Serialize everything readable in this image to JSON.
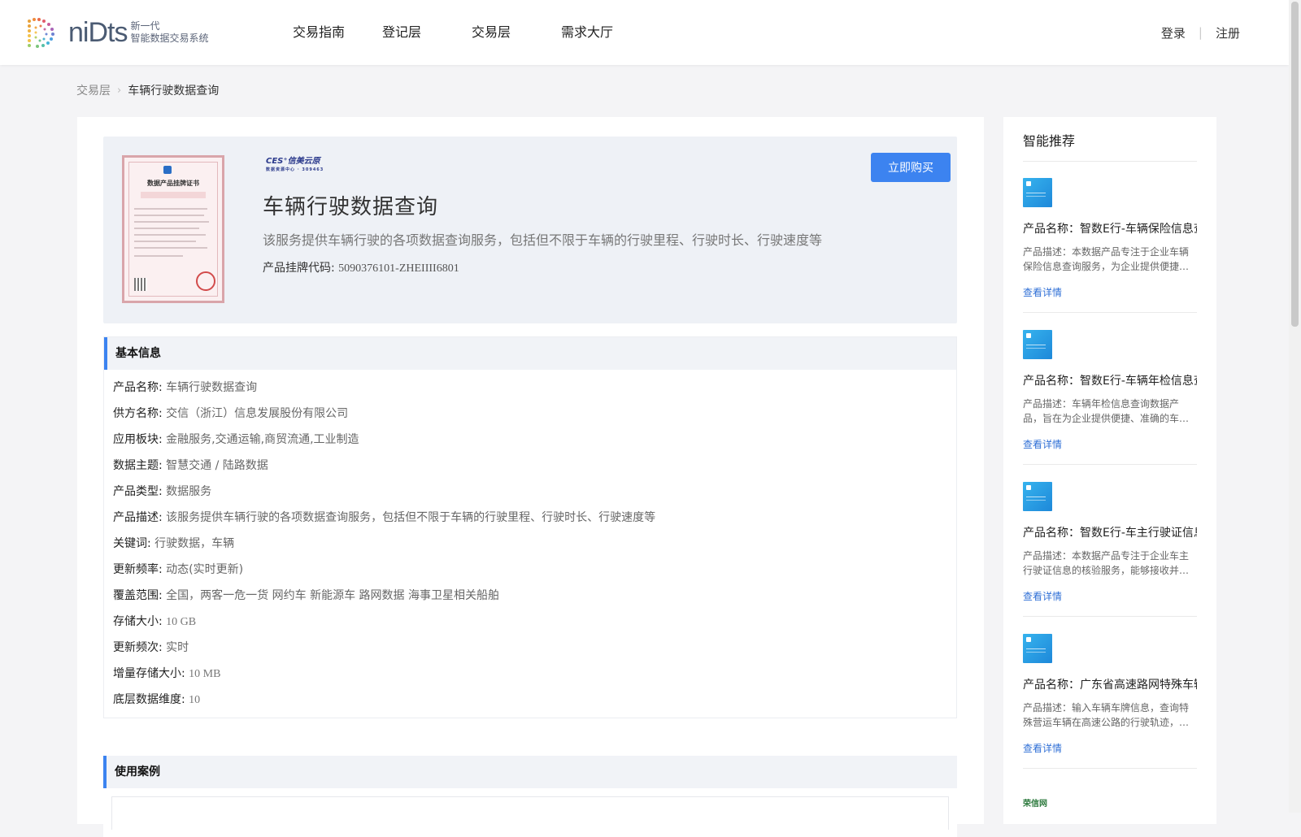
{
  "header": {
    "logo_word": "niDts",
    "logo_sub1": "新一代",
    "logo_sub2": "智能数据交易系统",
    "nav": [
      "交易指南",
      "登记层",
      "交易层",
      "需求大厅"
    ],
    "login": "登录",
    "register": "注册"
  },
  "breadcrumb": {
    "parent": "交易层",
    "current": "车辆行驶数据查询"
  },
  "product": {
    "ces_logo": "CES⁺信美云原",
    "ces_sub": "数据资源中心 · 309463",
    "cert_title": "数据产品挂牌证书",
    "title": "车辆行驶数据查询",
    "description": "该服务提供车辆行驶的各项数据查询服务，包括但不限于车辆的行驶里程、行驶时长、行驶速度等",
    "code_label": "产品挂牌代码:",
    "code_value": "5090376101-ZHEIIII6801",
    "buy_button": "立即购买"
  },
  "basic_info": {
    "heading": "基本信息",
    "rows": [
      {
        "label": "产品名称:",
        "value": "车辆行驶数据查询"
      },
      {
        "label": "供方名称:",
        "value": "交信（浙江）信息发展股份有限公司"
      },
      {
        "label": "应用板块:",
        "value": "金融服务,交通运输,商贸流通,工业制造"
      },
      {
        "label": "数据主题:",
        "value": "智慧交通 / 陆路数据"
      },
      {
        "label": "产品类型:",
        "value": "数据服务"
      },
      {
        "label": "产品描述:",
        "value": "该服务提供车辆行驶的各项数据查询服务，包括但不限于车辆的行驶里程、行驶时长、行驶速度等"
      },
      {
        "label": "关键词:",
        "value": "行驶数据，车辆"
      },
      {
        "label": "更新频率:",
        "value": "动态(实时更新)"
      },
      {
        "label": "覆盖范围:",
        "value": "全国，两客一危一货 网约车 新能源车 路网数据 海事卫星相关船舶"
      },
      {
        "label": "存储大小:",
        "value": "10 GB"
      },
      {
        "label": "更新频次:",
        "value": "实时"
      },
      {
        "label": "增量存储大小:",
        "value": "10 MB"
      },
      {
        "label": "底层数据维度:",
        "value": "10"
      }
    ]
  },
  "use_case": {
    "heading": "使用案例"
  },
  "sidebar": {
    "title": "智能推荐",
    "link_label": "查看详情",
    "items": [
      {
        "name": "产品名称：智数E行-车辆保险信息查询",
        "desc": "产品描述：本数据产品专注于企业车辆保险信息查询服务，为企业提供便捷、准确的车辆保险信息"
      },
      {
        "name": "产品名称：智数E行-车辆年检信息查询",
        "desc": "产品描述：车辆年检信息查询数据产品，旨在为企业提供便捷、准确的车辆年检信息"
      },
      {
        "name": "产品名称：智数E行-车主行驶证信息核验",
        "desc": "产品描述：本数据产品专注于企业车主行驶证信息的核验服务，能够接收并核验信息"
      },
      {
        "name": "产品名称：广东省高速路网特殊车辆轨迹查询",
        "desc": "产品描述：输入车辆车牌信息，查询特殊营运车辆在高速公路的行驶轨迹，返回结果"
      }
    ],
    "last_logo": "荣信网"
  }
}
